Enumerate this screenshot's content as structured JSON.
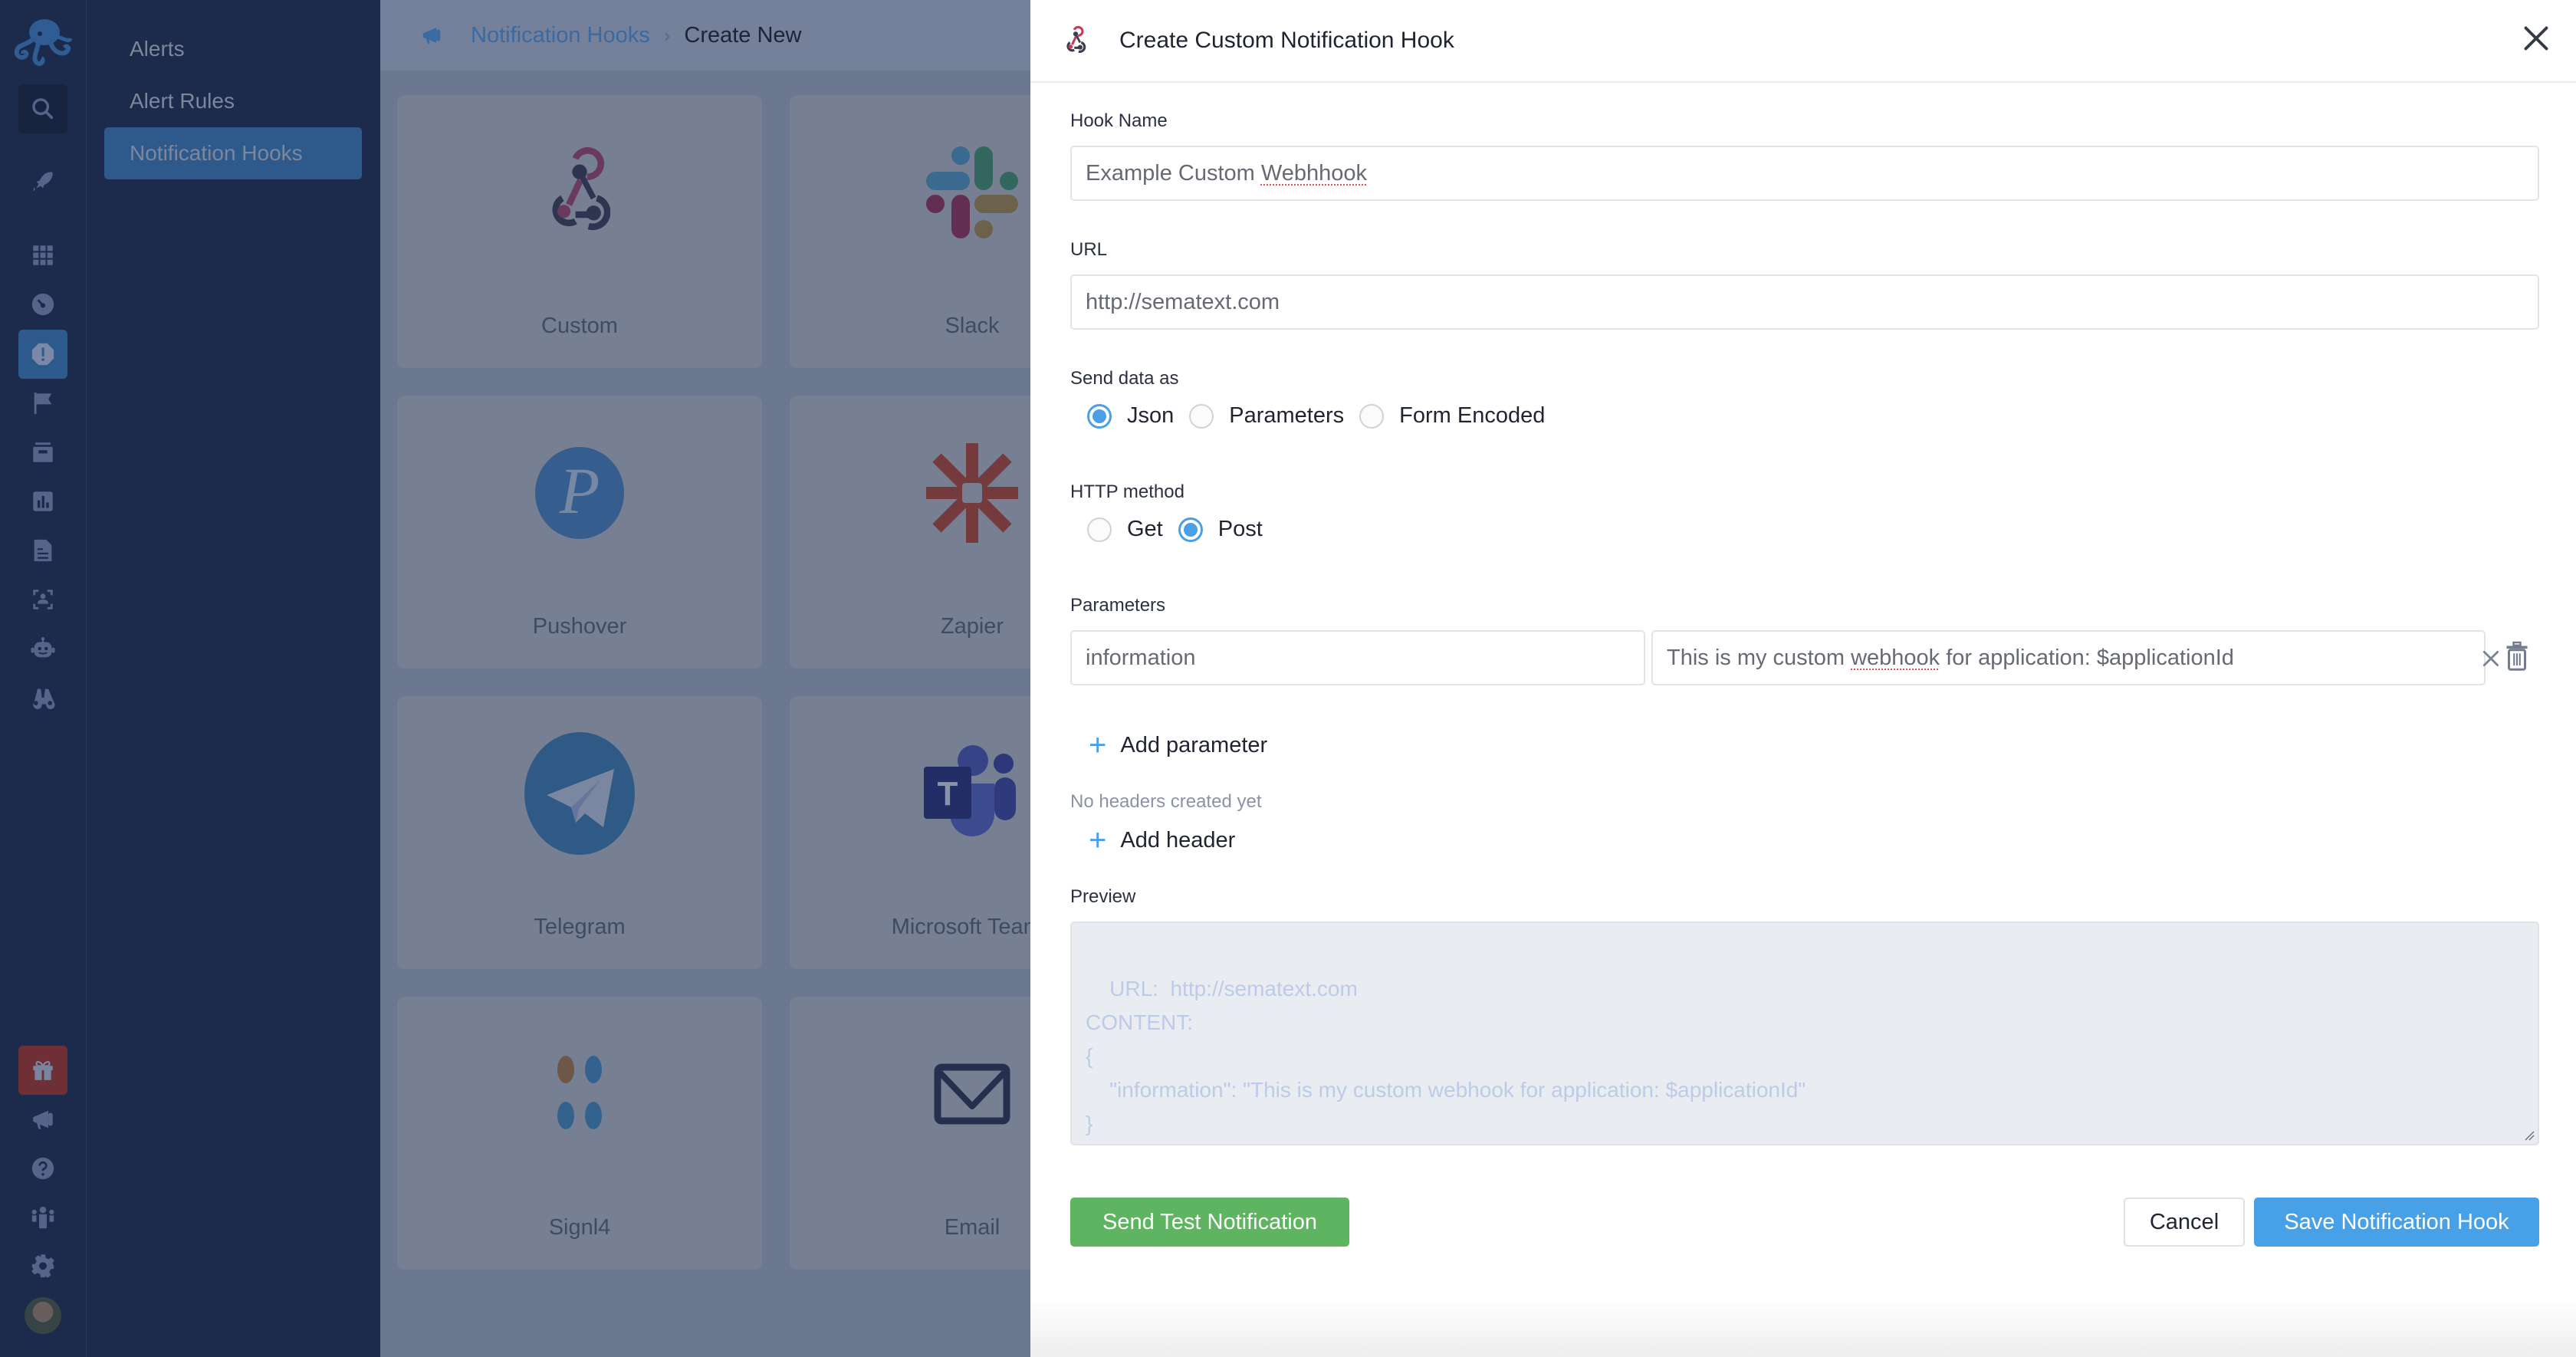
{
  "rail": {
    "icons": [
      "logo-octopus-icon",
      "search-icon",
      "rocket-icon",
      "apps-grid-icon",
      "dashboard-gauge-icon",
      "alert-octagon-icon",
      "flag-icon",
      "archive-icon",
      "chart-icon",
      "document-icon",
      "user-scan-icon",
      "robot-icon",
      "binoculars-icon",
      "gift-icon",
      "megaphone-icon",
      "help-icon",
      "team-icon",
      "settings-gear-icon",
      "avatar"
    ],
    "active": "alert-octagon-icon"
  },
  "subnav": {
    "items": [
      {
        "label": "Alerts",
        "active": false
      },
      {
        "label": "Alert Rules",
        "active": false
      },
      {
        "label": "Notification Hooks",
        "active": true
      }
    ]
  },
  "breadcrumb": {
    "parent": "Notification Hooks",
    "separator": "›",
    "current": "Create New"
  },
  "integrations": [
    {
      "name": "Custom",
      "icon": "webhook-icon"
    },
    {
      "name": "Slack",
      "icon": "slack-icon"
    },
    {
      "name": "Pushover",
      "icon": "pushover-icon"
    },
    {
      "name": "Zapier",
      "icon": "zapier-icon"
    },
    {
      "name": "Telegram",
      "icon": "telegram-icon"
    },
    {
      "name": "Microsoft Teams",
      "icon": "teams-icon"
    },
    {
      "name": "Signl4",
      "icon": "signl4-icon"
    },
    {
      "name": "Email",
      "icon": "envelope-icon"
    }
  ],
  "drawer": {
    "title": "Create Custom Notification Hook",
    "hook_name": {
      "label": "Hook Name",
      "value_prefix": "Example Custom ",
      "value_misspelled": "Webhhook"
    },
    "url": {
      "label": "URL",
      "value": "http://sematext.com"
    },
    "send_data_as": {
      "label": "Send data as",
      "options": [
        "Json",
        "Parameters",
        "Form Encoded"
      ],
      "selected": "Json"
    },
    "http_method": {
      "label": "HTTP method",
      "options": [
        "Get",
        "Post"
      ],
      "selected": "Post"
    },
    "parameters": {
      "label": "Parameters",
      "rows": [
        {
          "key": "information",
          "value_prefix": "This is my custom ",
          "value_misspelled": "webhook",
          "value_suffix": " for application: $applicationId"
        }
      ],
      "add_label": "Add parameter"
    },
    "headers": {
      "empty_text": "No headers created yet",
      "add_label": "Add header"
    },
    "preview": {
      "label": "Preview",
      "text": "URL:  http://sematext.com\nCONTENT:\n{\n    \"information\": \"This is my custom webhook for application: $applicationId\"\n}"
    },
    "buttons": {
      "test": "Send Test Notification",
      "cancel": "Cancel",
      "save": "Save Notification Hook"
    }
  },
  "colors": {
    "accent": "#48a0e6",
    "success": "#5eb460",
    "nav_bg": "#1c2a4c",
    "nav_active": "#2e5a8b"
  }
}
